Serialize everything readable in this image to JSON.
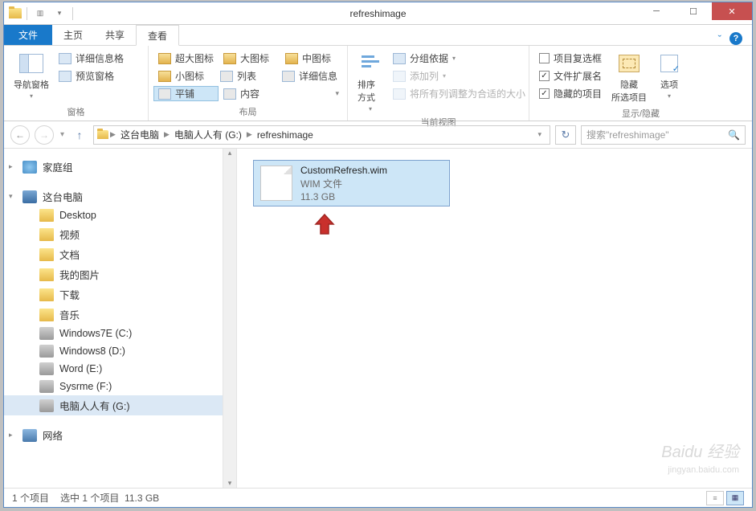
{
  "titlebar": {
    "title": "refreshimage"
  },
  "tabs": {
    "file": "文件",
    "home": "主页",
    "share": "共享",
    "view": "查看"
  },
  "ribbon": {
    "panes": {
      "nav_pane": "导航窗格",
      "details_pane": "详细信息格",
      "preview_pane": "预览窗格",
      "group_label": "窗格"
    },
    "layout": {
      "extra_large": "超大图标",
      "large": "大图标",
      "medium": "中图标",
      "small": "小图标",
      "list": "列表",
      "details": "详细信息",
      "tiles": "平铺",
      "content": "内容",
      "group_label": "布局"
    },
    "current_view": {
      "sort_by": "排序方式",
      "group_by": "分组依据",
      "add_columns": "添加列",
      "autosize": "将所有列调整为合适的大小",
      "group_label": "当前视图"
    },
    "show_hide": {
      "item_checkboxes": "项目复选框",
      "file_ext": "文件扩展名",
      "hidden_items": "隐藏的项目",
      "hide_selected": "隐藏",
      "hide_selected_sub": "所选项目",
      "options": "选项",
      "group_label": "显示/隐藏"
    }
  },
  "breadcrumb": {
    "this_pc": "这台电脑",
    "drive": "电脑人人有 (G:)",
    "folder": "refreshimage"
  },
  "search": {
    "placeholder": "搜索\"refreshimage\""
  },
  "tree": {
    "homegroup": "家庭组",
    "this_pc": "这台电脑",
    "items": [
      "Desktop",
      "视频",
      "文档",
      "我的图片",
      "下载",
      "音乐",
      "Windows7E (C:)",
      "Windows8 (D:)",
      "Word (E:)",
      "Sysrme (F:)",
      "电脑人人有 (G:)"
    ],
    "network": "网络"
  },
  "file": {
    "name": "CustomRefresh.wim",
    "type": "WIM 文件",
    "size": "11.3 GB"
  },
  "status": {
    "count": "1 个项目",
    "selected": "选中 1 个项目",
    "size": "11.3 GB"
  },
  "watermark": {
    "main": "Baidu 经验",
    "sub": "jingyan.baidu.com"
  }
}
